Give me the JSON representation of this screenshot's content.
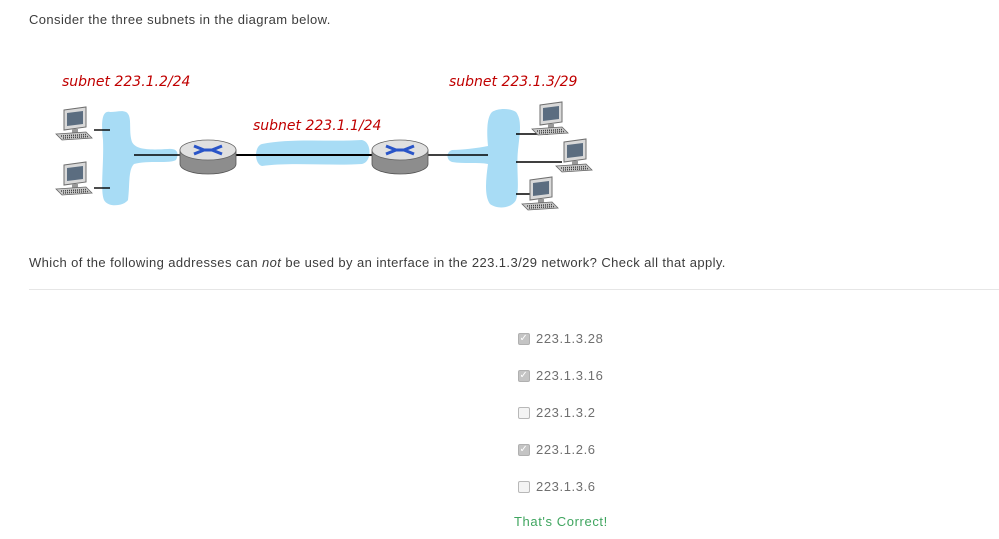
{
  "intro_text": "Consider the three subnets in the diagram below.",
  "diagram": {
    "subnet_left_label": "subnet 223.1.2/24",
    "subnet_middle_label": "subnet 223.1.1/24",
    "subnet_right_label": "subnet 223.1.3/29",
    "subnet_fill_color": "#a8dcf5",
    "router_icon": "router-icon",
    "host_icon": "desktop-computer-icon"
  },
  "question": {
    "before": "Which of the following addresses can ",
    "emphasis": "not",
    "after": " be used by an interface in the 223.1.3/29 network? Check all that apply."
  },
  "options": [
    {
      "label": "223.1.3.28",
      "checked": true
    },
    {
      "label": "223.1.3.16",
      "checked": true
    },
    {
      "label": "223.1.3.2",
      "checked": false
    },
    {
      "label": "223.1.2.6",
      "checked": true
    },
    {
      "label": "223.1.3.6",
      "checked": false
    }
  ],
  "feedback": "That's Correct!",
  "colors": {
    "label_red": "#c00000",
    "feedback_green": "#3fa55f",
    "text_gray": "#3c3c3c"
  }
}
